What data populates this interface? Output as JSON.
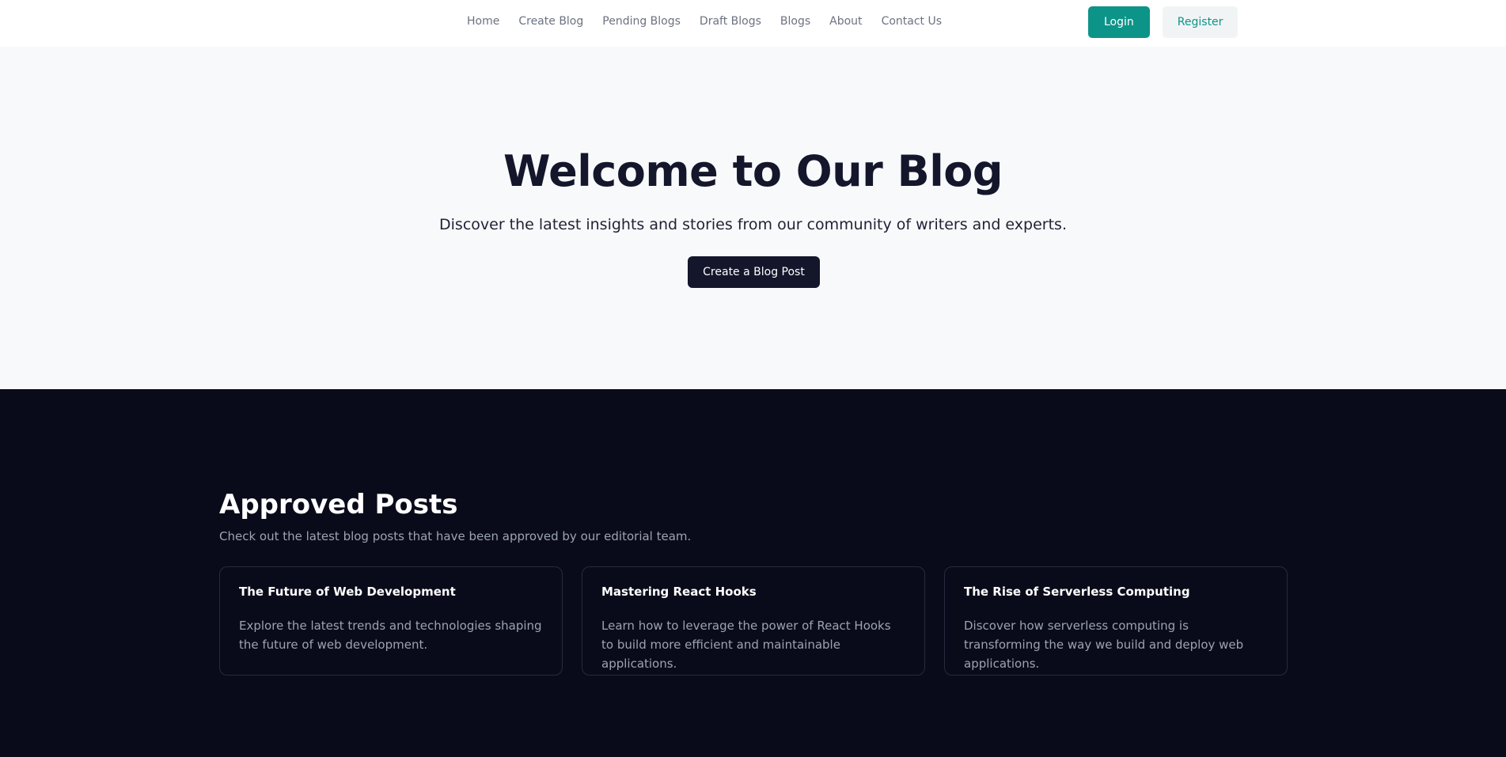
{
  "nav": {
    "items": [
      {
        "label": "Home"
      },
      {
        "label": "Create Blog"
      },
      {
        "label": "Pending Blogs"
      },
      {
        "label": "Draft Blogs"
      },
      {
        "label": "Blogs"
      },
      {
        "label": "About"
      },
      {
        "label": "Contact Us"
      }
    ],
    "login_label": "Login",
    "register_label": "Register"
  },
  "hero": {
    "title": "Welcome to Our Blog",
    "subtitle": "Discover the latest insights and stories from our community of writers and experts.",
    "cta_label": "Create a Blog Post"
  },
  "approved": {
    "title": "Approved Posts",
    "subtitle": "Check out the latest blog posts that have been approved by our editorial team.",
    "cards": [
      {
        "title": "The Future of Web Development",
        "excerpt": "Explore the latest trends and technologies shaping the future of web development."
      },
      {
        "title": "Mastering React Hooks",
        "excerpt": "Learn how to leverage the power of React Hooks to build more efficient and maintainable applications."
      },
      {
        "title": "The Rise of Serverless Computing",
        "excerpt": "Discover how serverless computing is transforming the way we build and deploy web applications."
      }
    ]
  },
  "colors": {
    "accent": "#0d9488",
    "hero_bg": "#f8f9fb",
    "dark_bg": "#0a0b1a",
    "heading_dark": "#14162b"
  }
}
